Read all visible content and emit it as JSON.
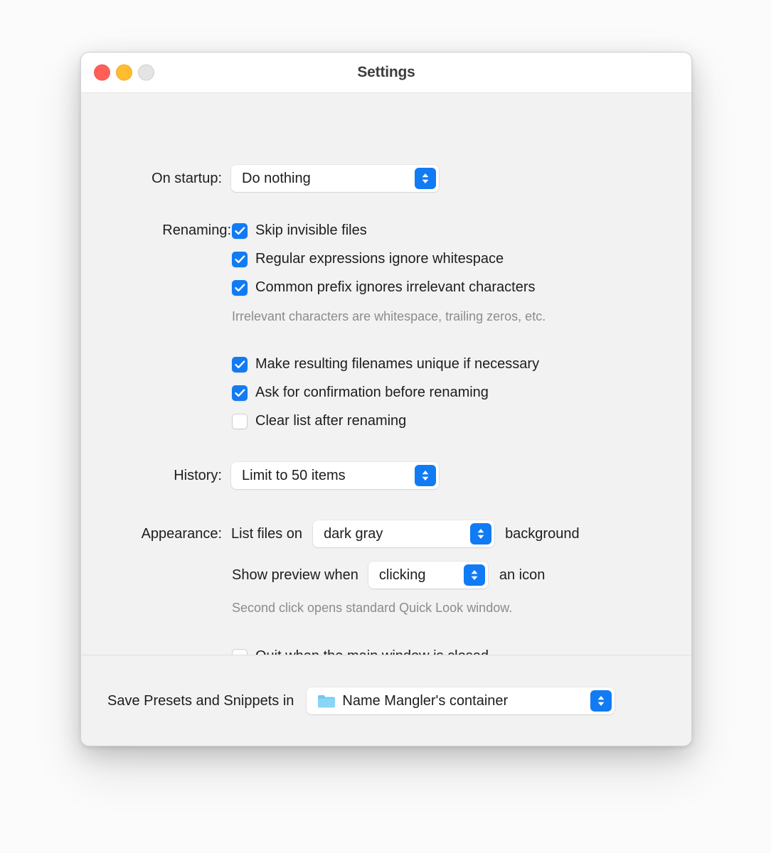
{
  "window": {
    "title": "Settings",
    "traffic_lights": [
      {
        "name": "close",
        "color": "#ff5f57"
      },
      {
        "name": "minimize",
        "color": "#febc2e"
      },
      {
        "name": "zoom",
        "color": "#e4e4e4"
      }
    ]
  },
  "colors": {
    "accent": "#117bf4",
    "window_bg": "#f2f2f2",
    "titlebar_bg": "#ffffff",
    "text": "#1d1d1f",
    "help_text": "#8b8b90"
  },
  "settings": {
    "startup": {
      "label": "On startup:",
      "value": "Do nothing"
    },
    "renaming": {
      "label": "Renaming:",
      "checkboxes": [
        {
          "label": "Skip invisible files",
          "checked": true
        },
        {
          "label": "Regular expressions ignore whitespace",
          "checked": true
        },
        {
          "label": "Common prefix ignores irrelevant characters",
          "checked": true
        }
      ],
      "help": "Irrelevant characters are whitespace, trailing zeros, etc.",
      "checkboxes2": [
        {
          "label": "Make resulting filenames unique if necessary",
          "checked": true
        },
        {
          "label": "Ask for confirmation before renaming",
          "checked": true
        },
        {
          "label": "Clear list after renaming",
          "checked": false
        }
      ]
    },
    "history": {
      "label": "History:",
      "value": "Limit to 50 items"
    },
    "appearance": {
      "label": "Appearance:",
      "list_files_prefix": "List files on",
      "background_value": "dark gray",
      "list_files_suffix": "background",
      "preview_prefix": "Show preview when",
      "preview_value": "clicking",
      "preview_suffix": "an icon",
      "help": "Second click opens standard Quick Look window.",
      "quit_checkbox": {
        "label": "Quit when the main window is closed",
        "checked": false
      }
    }
  },
  "footer": {
    "label": "Save Presets and Snippets in",
    "value": "Name Mangler's container",
    "icon": "folder-icon"
  }
}
